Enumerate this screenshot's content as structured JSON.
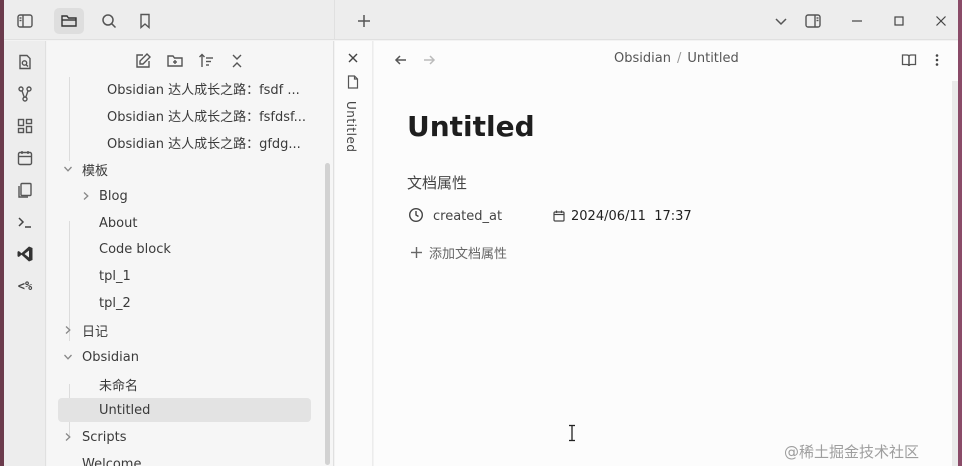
{
  "topbar": {
    "left_icons": [
      "sidebar-toggle-icon",
      "folder-icon",
      "search-icon",
      "bookmark-icon"
    ],
    "new_tab_icon": "plus-icon",
    "right_icons": [
      "chevron-down-icon",
      "reading-view-toggle-icon",
      "minimize-icon",
      "maximize-icon",
      "close-icon"
    ]
  },
  "ribbon": {
    "icons": [
      "quick-switcher-icon",
      "graph-view-icon",
      "canvas-icon",
      "daily-note-icon",
      "templates-icon",
      "terminal-icon",
      "vscode-icon",
      "templater-icon"
    ]
  },
  "sidebar": {
    "toolbar_icons": [
      "new-note-icon",
      "new-folder-icon",
      "sort-icon",
      "collapse-all-icon"
    ],
    "tree": {
      "item_fsdf": "Obsidian 达人成长之路：fsdf ...",
      "item_fsfdsf": "Obsidian 达人成长之路：fsfdsf...",
      "item_gfdg": "Obsidian 达人成长之路：gfdg...",
      "folder_templates": "模板",
      "folder_blog": "Blog",
      "note_about": "About",
      "note_code_block": "Code block",
      "note_tpl1": "tpl_1",
      "note_tpl2": "tpl_2",
      "folder_diary": "日记",
      "folder_obsidian": "Obsidian",
      "note_untitled_cn": "未命名",
      "note_untitled": "Untitled",
      "folder_scripts": "Scripts",
      "note_welcome": "Welcome"
    }
  },
  "vertical_tab": {
    "label": "Untitled"
  },
  "editor": {
    "breadcrumb": {
      "folder": "Obsidian",
      "separator": "/",
      "note": "Untitled"
    },
    "title": "Untitled",
    "properties_heading": "文档属性",
    "property": {
      "key": "created_at",
      "value": "2024/06/11  17:37"
    },
    "add_property_label": "添加文档属性"
  },
  "watermark": "@稀土掘金技术社区",
  "colors": {
    "window_frame": "#6b3b4c",
    "selected_item": "#e3e3e3",
    "topbar_bg": "#ededed"
  }
}
